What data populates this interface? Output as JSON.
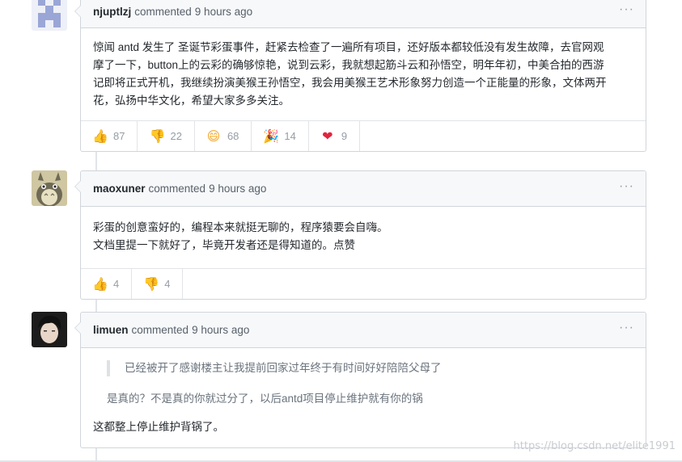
{
  "comments": [
    {
      "author": "njuptlzj",
      "verb": "commented",
      "time": "9 hours ago",
      "more": "···",
      "body_lines": [
        "惊闻 antd 发生了 圣诞节彩蛋事件，赶紧去检查了一遍所有项目，还好版本都较低没有发生故障，去官网观",
        "摩了一下，button上的云彩的确够惊艳，说到云彩，我就想起筋斗云和孙悟空，明年年初，中美合拍的西游",
        "记即将正式开机，我继续扮演美猴王孙悟空，我会用美猴王艺术形象努力创造一个正能量的形象，文体两开",
        "花，弘扬中华文化，希望大家多多关注。"
      ],
      "reactions": [
        {
          "icon": "thumbs-up-icon",
          "glyph": "👍",
          "color": "#f5a623",
          "count": "87"
        },
        {
          "icon": "thumbs-down-icon",
          "glyph": "👎",
          "color": "#f5a623",
          "count": "22"
        },
        {
          "icon": "laugh-icon",
          "glyph": "😄",
          "color": "#f5a623",
          "count": "68"
        },
        {
          "icon": "tada-icon",
          "glyph": "🎉",
          "color": "#e5a33a",
          "count": "14"
        },
        {
          "icon": "heart-icon",
          "glyph": "❤",
          "color": "#e0243e",
          "count": "9"
        }
      ]
    },
    {
      "author": "maoxuner",
      "verb": "commented",
      "time": "9 hours ago",
      "more": "···",
      "body_lines": [
        "彩蛋的创意蛮好的，编程本来就挺无聊的，程序猿要会自嗨。",
        "文档里提一下就好了，毕竟开发者还是得知道的。点赞"
      ],
      "reactions": [
        {
          "icon": "thumbs-up-icon",
          "glyph": "👍",
          "color": "#f5a623",
          "count": "4"
        },
        {
          "icon": "thumbs-down-icon",
          "glyph": "👎",
          "color": "#f5a623",
          "count": "4"
        }
      ]
    },
    {
      "author": "limuen",
      "verb": "commented",
      "time": "9 hours ago",
      "more": "···",
      "quote": "已经被开了感谢楼主让我提前回家过年终于有时间好好陪陪父母了",
      "quote_reply": "是真的？不是真的你就过分了，以后antd项目停止维护就有你的锅",
      "body_lines": [
        "这都整上停止维护背锅了。"
      ]
    }
  ],
  "watermark": "https://blog.csdn.net/elite1991"
}
